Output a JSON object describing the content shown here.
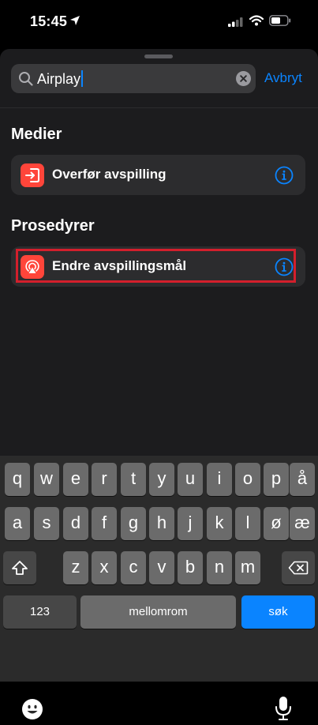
{
  "status_bar": {
    "time": "15:45"
  },
  "search": {
    "value": "Airplay",
    "cancel_label": "Avbryt"
  },
  "sections": [
    {
      "title": "Medier",
      "items": [
        {
          "label": "Overfør avspilling"
        }
      ]
    },
    {
      "title": "Prosedyrer",
      "items": [
        {
          "label": "Endre avspillingsmål"
        }
      ]
    }
  ],
  "keyboard": {
    "row1": [
      "q",
      "w",
      "e",
      "r",
      "t",
      "y",
      "u",
      "i",
      "o",
      "p",
      "å"
    ],
    "row2": [
      "a",
      "s",
      "d",
      "f",
      "g",
      "h",
      "j",
      "k",
      "l",
      "ø",
      "æ"
    ],
    "row3": [
      "z",
      "x",
      "c",
      "v",
      "b",
      "n",
      "m"
    ],
    "numbers_label": "123",
    "space_label": "mellomrom",
    "return_label": "søk"
  },
  "colors": {
    "accent": "#0a84ff",
    "app_icon": "#ff453a",
    "highlight": "#d31f2c"
  }
}
